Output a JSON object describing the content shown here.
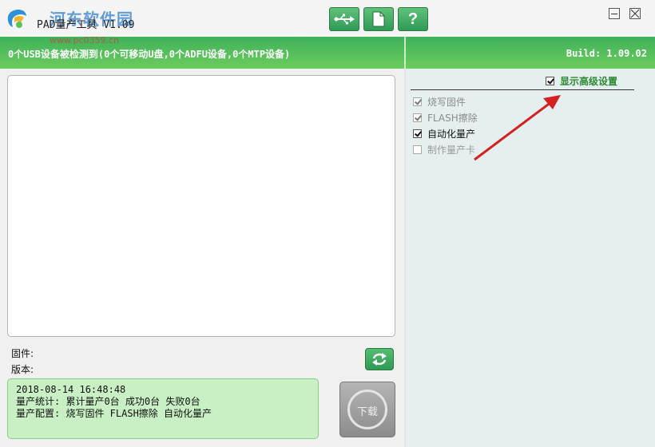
{
  "window": {
    "title": "PAD量产工具 V1.09",
    "watermark_main": "河东软件园",
    "watermark_sub": "www.pc0359.cn"
  },
  "toolbar": {
    "buttons": [
      {
        "name": "usb-button",
        "icon": "usb-icon"
      },
      {
        "name": "document-button",
        "icon": "document-icon"
      },
      {
        "name": "help-button",
        "icon": "help-icon",
        "label": "?"
      }
    ],
    "window_controls": [
      "minimize",
      "close"
    ]
  },
  "status_bar": {
    "devices_text": "0个USB设备被检测到(0个可移动U盘,0个ADFU设备,0个MTP设备)",
    "build_text": "Build: 1.09.02"
  },
  "main": {
    "firmware_label": "固件:",
    "version_label": "版本:",
    "stats": {
      "datetime": "2018-08-14  16:48:48",
      "summary": "量产统计: 累计量产0台 成功0台 失败0台",
      "config": "量产配置: 烧写固件 FLASH擦除 自动化量产"
    },
    "download_label": "下载"
  },
  "settings": {
    "show_advanced_label": "显示高级设置",
    "show_advanced_checked": true,
    "options": [
      {
        "label": "烧写固件",
        "checked": true,
        "enabled": false
      },
      {
        "label": "FLASH擦除",
        "checked": true,
        "enabled": false
      },
      {
        "label": "自动化量产",
        "checked": true,
        "enabled": true
      },
      {
        "label": "制作量产卡",
        "checked": false,
        "enabled": false
      }
    ]
  },
  "colors": {
    "accent_green": "#3eb15a",
    "advanced_text": "#2c8a33",
    "annotation_arrow": "#d42020",
    "stats_background": "#c8f0c4"
  }
}
